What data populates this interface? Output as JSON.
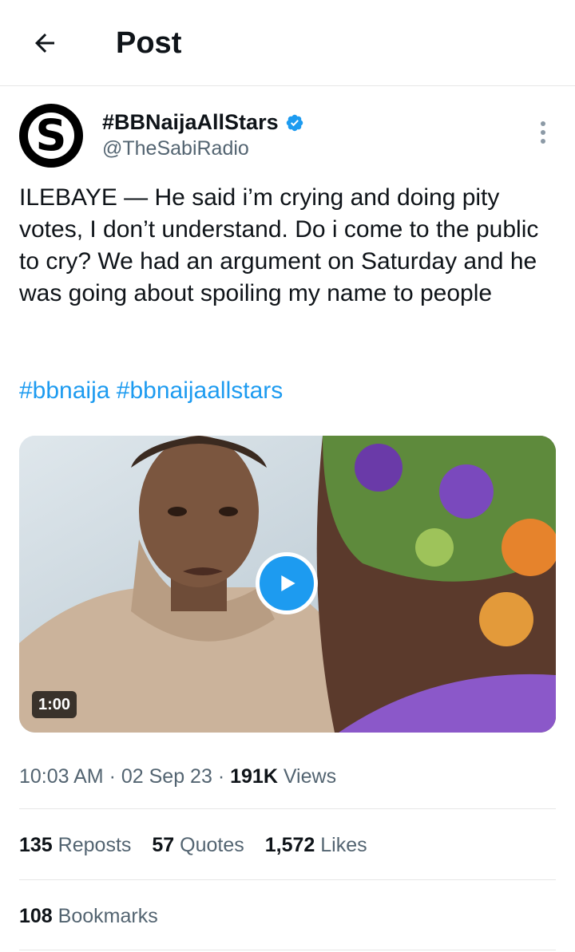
{
  "header": {
    "title": "Post",
    "back_icon": "arrow-left-icon"
  },
  "author": {
    "display_name": "#BBNaijaAllStars",
    "handle": "@TheSabiRadio",
    "avatar_letter": "S",
    "verified_icon": "verified-badge-icon"
  },
  "post": {
    "text": "ILEBAYE — He said i’m crying and doing pity votes, I don’t understand. Do i come to the public to cry? We had an argument on Saturday and he was going about spoiling my name to people",
    "hashtags": [
      "#bbnaija",
      "#bbnaijaallstars"
    ]
  },
  "media": {
    "duration": "1:00",
    "play_icon": "play-icon"
  },
  "meta": {
    "time": "10:03 AM",
    "date": "02 Sep 23",
    "views_count": "191K",
    "views_label": "Views"
  },
  "stats": {
    "reposts_count": "135",
    "reposts_label": "Reposts",
    "quotes_count": "57",
    "quotes_label": "Quotes",
    "likes_count": "1,572",
    "likes_label": "Likes",
    "bookmarks_count": "108",
    "bookmarks_label": "Bookmarks"
  },
  "colors": {
    "accent": "#1d9bf0",
    "text": "#0f1419",
    "secondary": "#536471",
    "divider": "#e6e6e6"
  }
}
